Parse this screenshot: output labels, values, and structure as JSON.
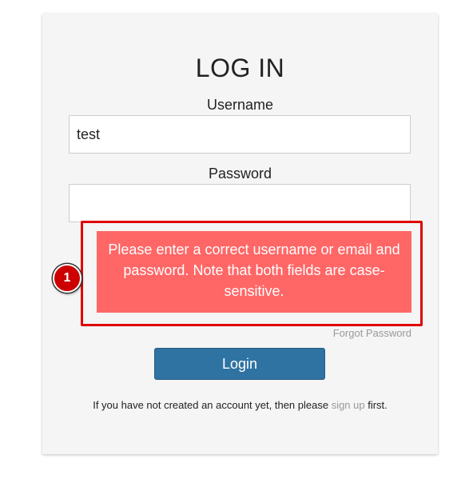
{
  "login": {
    "title": "LOG IN",
    "username_label": "Username",
    "username_value": "test",
    "password_label": "Password",
    "password_value": "",
    "error_message": "Please enter a correct username or email and password. Note that both fields are case-sensitive.",
    "forgot_link": "Forgot Password",
    "login_button": "Login",
    "signup_prefix": "If you have not created an account yet, then please ",
    "signup_link": "sign up",
    "signup_suffix": " first."
  },
  "annotation": {
    "marker_number": "1"
  },
  "colors": {
    "error_background": "#ff6666",
    "button_background": "#2f73a2",
    "highlight_border": "#e00000",
    "card_background": "#f5f5f5"
  }
}
